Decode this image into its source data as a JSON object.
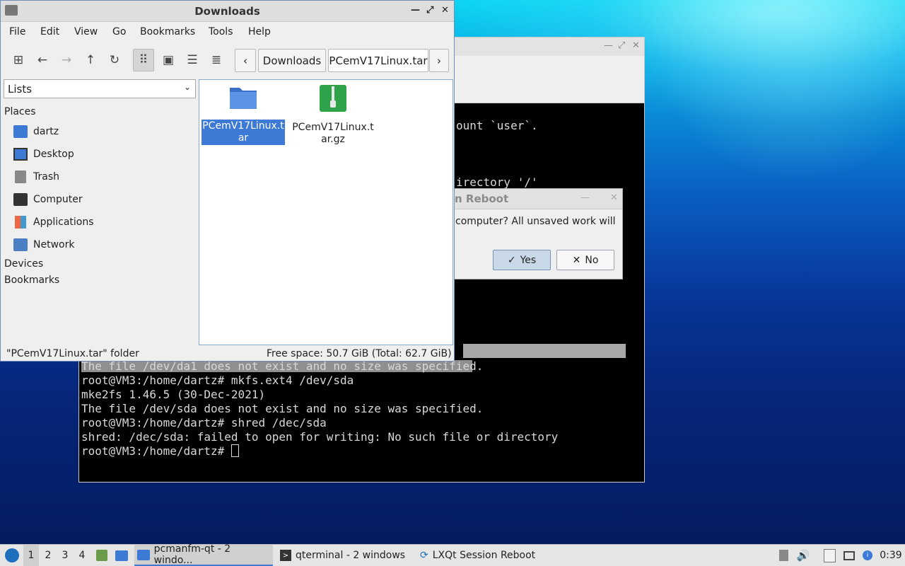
{
  "file_manager": {
    "title": "Downloads",
    "menu": [
      "File",
      "Edit",
      "View",
      "Go",
      "Bookmarks",
      "Tools",
      "Help"
    ],
    "breadcrumbs": [
      "Downloads",
      "PCemV17Linux.tar"
    ],
    "sidebar_mode": "Lists",
    "places_header": "Places",
    "places": [
      {
        "label": "dartz",
        "icon": "home-folder-icon"
      },
      {
        "label": "Desktop",
        "icon": "desktop-icon"
      },
      {
        "label": "Trash",
        "icon": "trash-icon"
      },
      {
        "label": "Computer",
        "icon": "computer-icon"
      },
      {
        "label": "Applications",
        "icon": "applications-icon"
      },
      {
        "label": "Network",
        "icon": "network-icon"
      }
    ],
    "devices_header": "Devices",
    "bookmarks_header": "Bookmarks",
    "files": [
      {
        "name": "PCemV17Linux.t\nar",
        "icon": "folder-icon",
        "selected": true
      },
      {
        "name": "PCemV17Linux.t\nar.gz",
        "icon": "archive-icon",
        "selected": false
      }
    ],
    "status_left": "\"PCemV17Linux.tar\" folder",
    "status_right": "Free space: 50.7 GiB (Total: 62.7 GiB)"
  },
  "terminal": {
    "partial_top": [
      "ount `user`.",
      "irectory '/'"
    ],
    "lines": [
      "The file /dev/da1 does not exist and no size was specified.",
      "root@VM3:/home/dartz# mkfs.ext4 /dev/sda",
      "mke2fs 1.46.5 (30-Dec-2021)",
      "The file /dev/sda does not exist and no size was specified.",
      "root@VM3:/home/dartz# shred /dec/sda",
      "shred: /dec/sda: failed to open for writing: No such file or directory",
      "root@VM3:/home/dartz# "
    ]
  },
  "dialog": {
    "title": "n Reboot",
    "message": "computer? All unsaved work will",
    "yes": "Yes",
    "no": "No"
  },
  "taskbar": {
    "desktops": [
      "1",
      "2",
      "3",
      "4"
    ],
    "tasks": [
      {
        "label": "pcmanfm-qt - 2 windo...",
        "icon": "folder-icon"
      },
      {
        "label": "qterminal - 2 windows",
        "icon": "terminal-icon"
      },
      {
        "label": "LXQt Session Reboot",
        "icon": "lxqt-icon"
      }
    ],
    "clock": "0:39"
  }
}
